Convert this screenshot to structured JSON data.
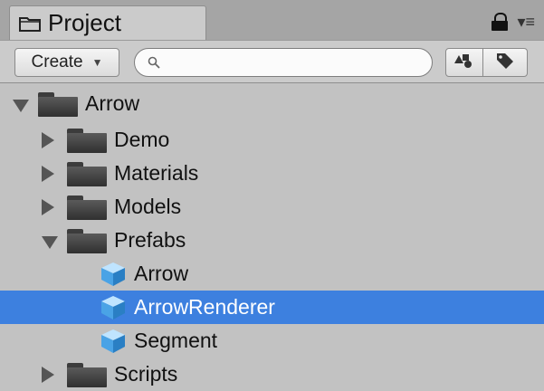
{
  "tab": {
    "label": "Project"
  },
  "toolbar": {
    "create_label": "Create",
    "create_arrow": "▼",
    "search_placeholder": "",
    "menu_glyph": "▾≡"
  },
  "tree": [
    {
      "label": "Arrow",
      "type": "folder",
      "depth": 0,
      "expanded": true
    },
    {
      "label": "Demo",
      "type": "folder",
      "depth": 1,
      "expanded": false
    },
    {
      "label": "Materials",
      "type": "folder",
      "depth": 1,
      "expanded": false
    },
    {
      "label": "Models",
      "type": "folder",
      "depth": 1,
      "expanded": false
    },
    {
      "label": "Prefabs",
      "type": "folder",
      "depth": 1,
      "expanded": true
    },
    {
      "label": "Arrow",
      "type": "prefab",
      "depth": 2
    },
    {
      "label": "ArrowRenderer",
      "type": "prefab",
      "depth": 2,
      "selected": true
    },
    {
      "label": "Segment",
      "type": "prefab",
      "depth": 2
    },
    {
      "label": "Scripts",
      "type": "folder",
      "depth": 1,
      "expanded": false
    }
  ],
  "colors": {
    "selection": "#3d80df",
    "panel_bg": "#c2c2c2",
    "folder": "#3c3c3c",
    "prefab_cube": "#4aa3e6"
  }
}
